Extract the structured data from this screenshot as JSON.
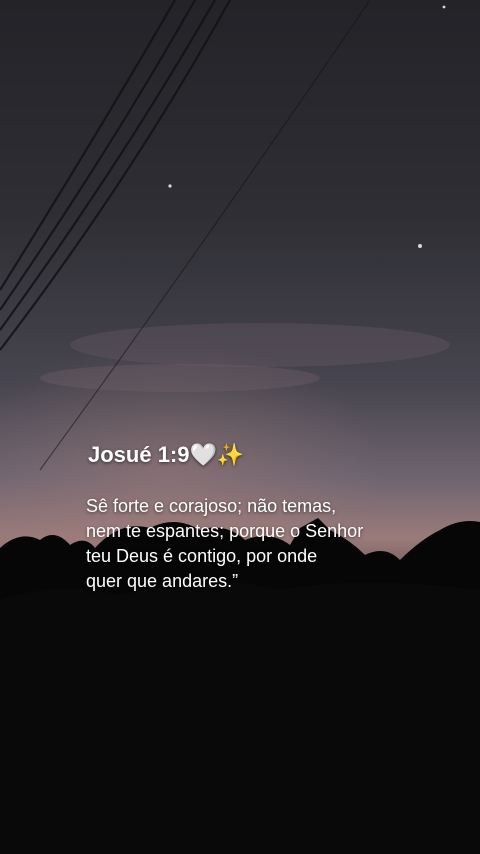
{
  "verse": {
    "reference": "Josué 1:9",
    "heart_emoji": "🤍",
    "sparkles_emoji": "✨",
    "text": "Sê forte e corajoso; não temas,\nnem te espantes; porque o Senhor\nteu Deus é contigo, por onde\nquer que andares.”"
  },
  "colors": {
    "sky_top": "#2b2b31",
    "sky_mid": "#55515d",
    "horizon_glow": "#a07c7a",
    "trees": "#070707"
  }
}
